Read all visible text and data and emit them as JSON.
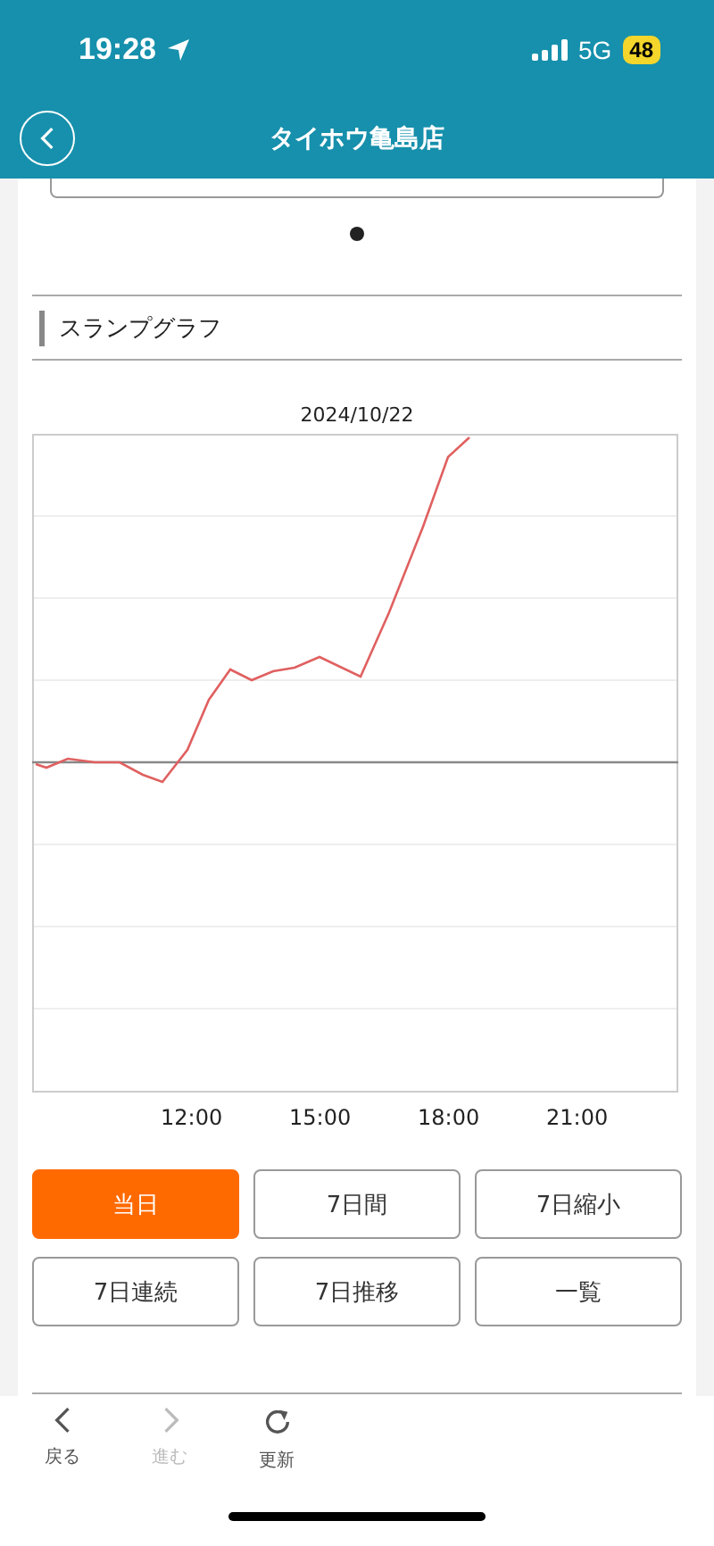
{
  "status_bar": {
    "time": "19:28",
    "network": "5G",
    "battery": "48"
  },
  "header": {
    "title": "タイホウ亀島店"
  },
  "section": {
    "title": "スランプグラフ"
  },
  "chart": {
    "date": "2024/10/22",
    "x_labels": [
      "12:00",
      "15:00",
      "18:00",
      "21:00"
    ]
  },
  "buttons": [
    {
      "label": "当日",
      "selected": true
    },
    {
      "label": "7日間",
      "selected": false
    },
    {
      "label": "7日縮小",
      "selected": false
    },
    {
      "label": "7日連続",
      "selected": false
    },
    {
      "label": "7日推移",
      "selected": false
    },
    {
      "label": "一覧",
      "selected": false
    }
  ],
  "toolbar": [
    {
      "kind": "back",
      "label": "戻る",
      "disabled": false
    },
    {
      "kind": "forward",
      "label": "進む",
      "disabled": true
    },
    {
      "kind": "reload",
      "label": "更新",
      "disabled": false
    }
  ]
}
